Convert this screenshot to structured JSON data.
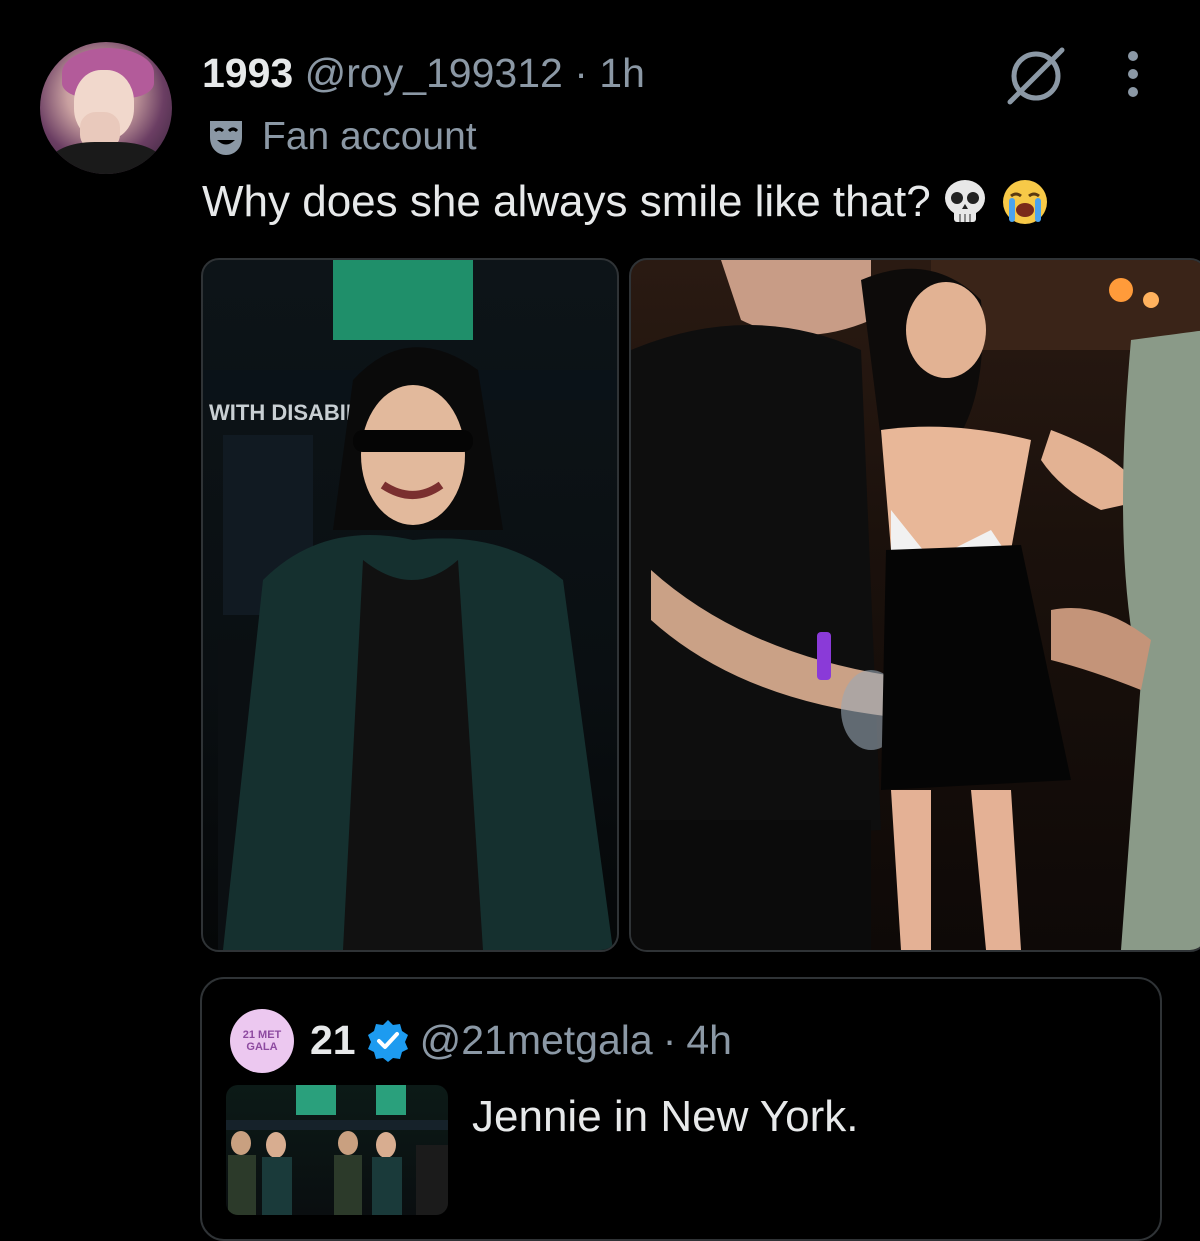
{
  "post": {
    "display_name": "1993",
    "handle": "@roy_199312",
    "separator": "·",
    "time": "1h",
    "label": "Fan account",
    "text": "Why does she always smile like that?",
    "emojis": [
      "skull-emoji",
      "loudly-crying-emoji"
    ],
    "photo_sign_text": "WITH DISABILIT"
  },
  "quote": {
    "avatar_text": "21 MET GALA",
    "display_name": "21",
    "handle": "@21metgala",
    "separator": "·",
    "time": "4h",
    "text": "Jennie in New York."
  },
  "icons": {
    "grok": "grok-icon",
    "more": "more-vertical-icon",
    "label_badge": "mask-icon",
    "verified": "verified-badge-icon"
  },
  "colors": {
    "background": "#000000",
    "primary_text": "#e7e9ea",
    "secondary_text": "#8b98a5",
    "border": "#2f3336",
    "verified": "#1d9bf0"
  }
}
